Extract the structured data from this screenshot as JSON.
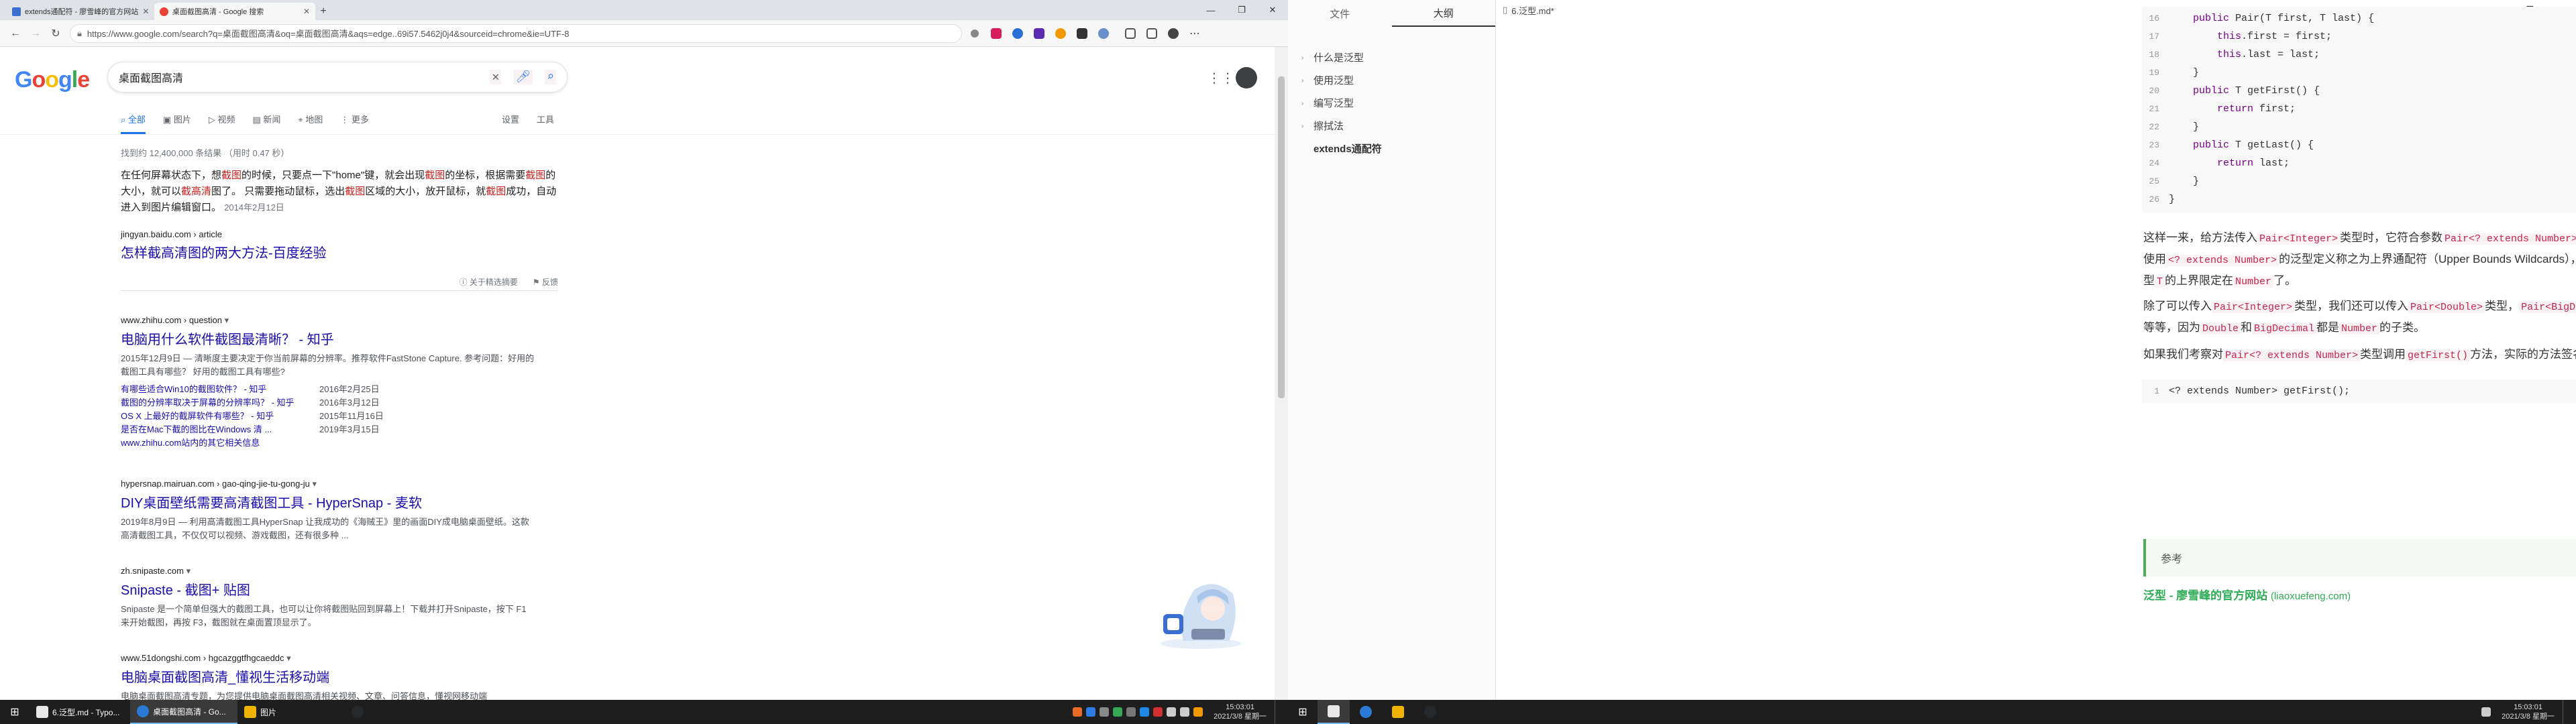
{
  "browser": {
    "tabs": [
      {
        "label": "extends通配符 - 廖雪峰的官方网站",
        "active": false
      },
      {
        "label": "桌面截图高清 - Google 搜索",
        "active": true
      }
    ],
    "new_tab": "+",
    "url": "https://www.google.com/search?q=桌面截图高清&oq=桌面截图高清&aqs=edge..69i57.5462j0j4&sourceid=chrome&ie=UTF-8",
    "window_controls": [
      "—",
      "❐",
      "✕"
    ],
    "nav": {
      "back": "←",
      "forward": "→",
      "refresh": "↻"
    }
  },
  "google": {
    "logo": "Google",
    "query": "桌面截图高清",
    "tabs": [
      "全部",
      "图片",
      "视频",
      "新闻",
      "地图",
      "更多"
    ],
    "tabs_right": [
      "设置",
      "工具"
    ],
    "stats": "找到约 12,400,000 条结果 （用时 0.47 秒）",
    "featured_snippet": {
      "text_parts": [
        {
          "t": "在任何屏幕状态下，想",
          "h": false
        },
        {
          "t": "截图",
          "h": true
        },
        {
          "t": "的时候，只要点一下\"home\"键，就会出现",
          "h": false
        },
        {
          "t": "截图",
          "h": true
        },
        {
          "t": "的坐标，根据需要",
          "h": false
        },
        {
          "t": "截图",
          "h": true
        },
        {
          "t": "的大小，就可以",
          "h": false
        },
        {
          "t": "截",
          "h": true
        },
        {
          "t": "高清",
          "h": true
        },
        {
          "t": "图了。 只需要拖动鼠标，选出",
          "h": false
        },
        {
          "t": "截图",
          "h": true
        },
        {
          "t": "区域的大小，放开鼠标，就",
          "h": false
        },
        {
          "t": "截图",
          "h": true
        },
        {
          "t": "成功，自动进入到图片编辑窗口。",
          "h": false
        }
      ],
      "date": "2014年2月12日",
      "cite": "jingyan.baidu.com › article",
      "title": "怎样截高清图的两大方法-百度经验",
      "about": "关于精选摘要",
      "feedback": "反馈"
    },
    "results": [
      {
        "cite": "www.zhihu.com › question",
        "title": "电脑用什么软件截图最清晰？ - 知乎",
        "desc": "2015年12月9日 — 清晰度主要决定于你当前屏幕的分辨率。推荐软件FastStone Capture. 参考问题：好用的截图工具有哪些？ 好用的截图工具有哪些?",
        "sublinks": [
          {
            "t": "有哪些适合Win10的截图软件？ - 知乎",
            "d": "2016年2月25日"
          },
          {
            "t": "截图的分辨率取决于屏幕的分辨率吗？ - 知乎",
            "d": "2016年3月12日"
          },
          {
            "t": "OS X 上最好的截屏软件有哪些？ - 知乎",
            "d": "2015年11月16日"
          },
          {
            "t": "是否在Mac下截的图比在Windows 清 ...",
            "d": "2019年3月15日"
          }
        ],
        "more": "www.zhihu.com站内的其它相关信息"
      },
      {
        "cite": "hypersnap.mairuan.com › gao-qing-jie-tu-gong-ju",
        "title": "DIY桌面壁纸需要高清截图工具 - HyperSnap - 麦软",
        "desc": "2019年8月9日 — 利用高清截图工具HyperSnap 让我成功的《海贼王》里的画面DIY成电脑桌面壁纸。这款高清截图工具，不仅仅可以视频、游戏截图，还有很多种 ..."
      },
      {
        "cite": "zh.snipaste.com",
        "title": "Snipaste - 截图+ 贴图",
        "desc": "Snipaste 是一个简单但强大的截图工具，也可以让你将截图贴回到屏幕上！下载并打开Snipaste，按下 F1 来开始截图，再按 F3，截图就在桌面置顶显示了。"
      },
      {
        "cite": "www.51dongshi.com › hgcazggtfhgcaeddc",
        "title": "电脑桌面截图高清_懂视生活移动端",
        "desc": "电脑桌面截图高清专题，为您提供电脑桌面截图高清相关视频、文章、问答信息，懂视网移动端"
      }
    ]
  },
  "taskbar_left": {
    "start": "⊞",
    "items": [
      {
        "label": "6.泛型.md - Typo...",
        "color": "#e8e8e8",
        "active": false
      },
      {
        "label": "桌面截图高清 - Go...",
        "color": "#2b7bd6",
        "active": true
      },
      {
        "label": "图片",
        "color": "#f0b400",
        "active": false
      },
      {
        "label": "",
        "color": "#24292e",
        "active": false
      }
    ],
    "clock_time": "15:03:01",
    "clock_date": "2021/3/8 星期一"
  },
  "typora": {
    "title": "6.泛型.md*",
    "window_controls": [
      "—",
      "❐",
      "✕"
    ],
    "sidebar_tabs": [
      "文件",
      "大纲"
    ],
    "outline": [
      {
        "label": "什么是泛型",
        "caret": "›"
      },
      {
        "label": "使用泛型",
        "caret": "›"
      },
      {
        "label": "编写泛型",
        "caret": "›"
      },
      {
        "label": "擦拭法",
        "caret": "›"
      },
      {
        "label": "extends通配符",
        "caret": "",
        "active": true
      }
    ],
    "code1": [
      {
        "n": "16",
        "c": "    public Pair(T first, T last) {"
      },
      {
        "n": "17",
        "c": "        this.first = first;"
      },
      {
        "n": "18",
        "c": "        this.last = last;"
      },
      {
        "n": "19",
        "c": "    }"
      },
      {
        "n": "20",
        "c": "    public T getFirst() {"
      },
      {
        "n": "21",
        "c": "        return first;"
      },
      {
        "n": "22",
        "c": "    }"
      },
      {
        "n": "23",
        "c": "    public T getLast() {"
      },
      {
        "n": "24",
        "c": "        return last;"
      },
      {
        "n": "25",
        "c": "    }"
      },
      {
        "n": "26",
        "c": "}"
      }
    ],
    "p1": [
      {
        "t": "这样一来，给方法传入"
      },
      {
        "c": "Pair<Integer>"
      },
      {
        "t": "类型时，它符合参数"
      },
      {
        "c": "Pair<? extends Number>"
      },
      {
        "t": "类型。这种使用"
      },
      {
        "c": "<? extends Number>"
      },
      {
        "t": "的泛型定义称之为上界通配符（Upper Bounds Wildcards），即把泛型类型"
      },
      {
        "c": "T"
      },
      {
        "t": "的上界限定在"
      },
      {
        "c": "Number"
      },
      {
        "t": "了。"
      }
    ],
    "p2": [
      {
        "t": "除了可以传入"
      },
      {
        "c": "Pair<Integer>"
      },
      {
        "t": "类型，我们还可以传入"
      },
      {
        "c": "Pair<Double>"
      },
      {
        "t": "类型，"
      },
      {
        "c": "Pair<BigDecimal>"
      },
      {
        "t": "类型等等，因为"
      },
      {
        "c": "Double"
      },
      {
        "t": "和"
      },
      {
        "c": "BigDecimal"
      },
      {
        "t": "都是"
      },
      {
        "c": "Number"
      },
      {
        "t": "的子类。"
      }
    ],
    "p3": [
      {
        "t": "如果我们考察对"
      },
      {
        "c": "Pair<? extends Number>"
      },
      {
        "t": "类型调用"
      },
      {
        "c": "getFirst()"
      },
      {
        "t": "方法，实际的方法签名变成了："
      }
    ],
    "code2": [
      {
        "n": "1",
        "c": "<? extends Number> getFirst();"
      }
    ],
    "callout": "参考",
    "link_title": "泛型 - 廖雪峰的官方网站",
    "link_domain": "(liaoxuefeng.com)"
  },
  "taskbar_right": {
    "start": "⊞",
    "items": [
      {
        "label": "",
        "color": "#e8e8e8",
        "active": true
      },
      {
        "label": "",
        "color": "#2b7bd6",
        "active": false
      },
      {
        "label": "",
        "color": "#f0b400",
        "active": false
      },
      {
        "label": "",
        "color": "#24292e",
        "active": false
      }
    ],
    "clock_time": "15:03:01",
    "clock_date": "2021/3/8 星期一"
  }
}
